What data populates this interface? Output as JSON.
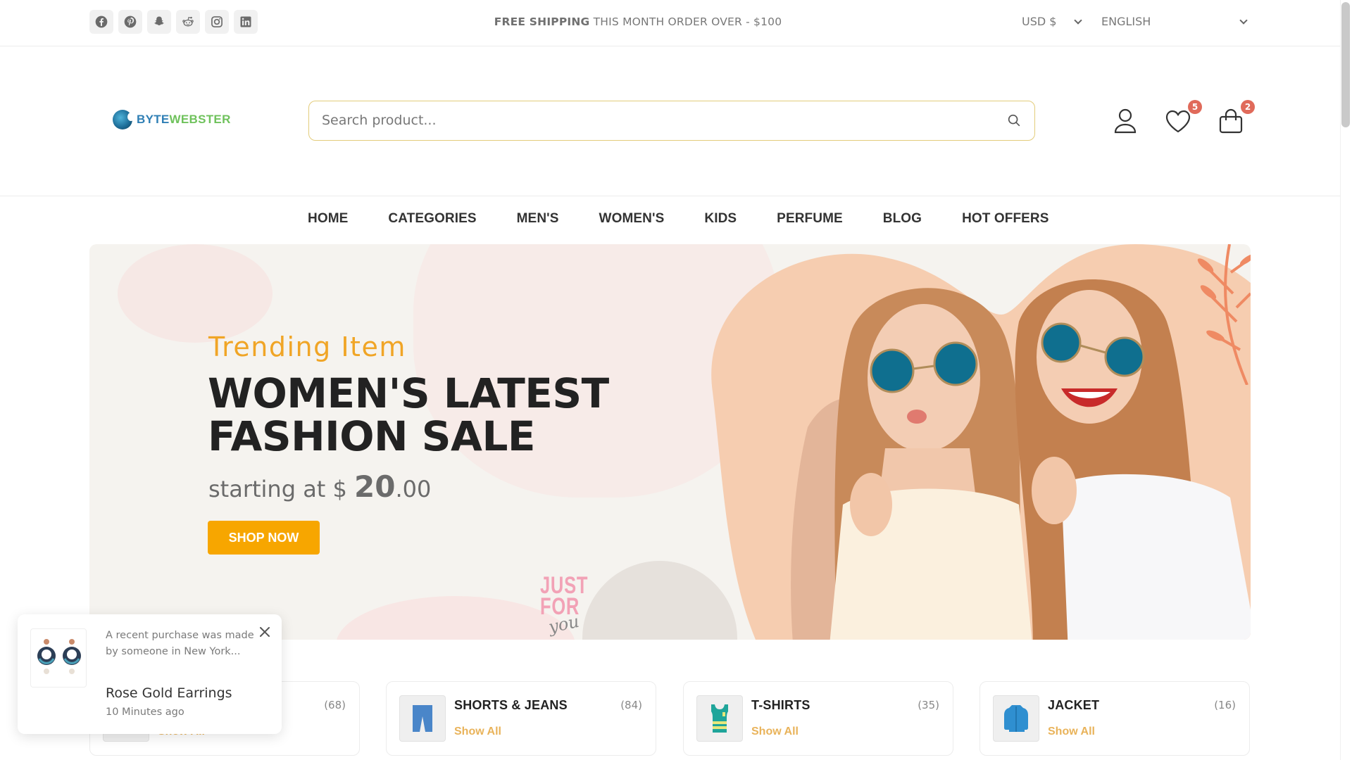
{
  "topbar": {
    "socials": [
      {
        "icon": "facebook-icon"
      },
      {
        "icon": "pinterest-icon"
      },
      {
        "icon": "snapchat-icon"
      },
      {
        "icon": "reddit-icon"
      },
      {
        "icon": "instagram-icon"
      },
      {
        "icon": "linkedin-icon"
      }
    ],
    "shipping_bold": "FREE SHIPPING",
    "shipping_rest": " THIS MONTH ORDER OVER - $100",
    "currency": "USD $",
    "language": "ENGLISH"
  },
  "header": {
    "logo_part1": "BYTE",
    "logo_part2": "WEBSTER",
    "search_placeholder": "Search product...",
    "wishlist_count": "5",
    "cart_count": "2"
  },
  "nav": {
    "items": [
      "HOME",
      "CATEGORIES",
      "MEN'S",
      "WOMEN'S",
      "KIDS",
      "PERFUME",
      "BLOG",
      "HOT OFFERS"
    ]
  },
  "hero": {
    "subtitle": "Trending Item",
    "title_line1": "WOMEN'S LATEST",
    "title_line2": "FASHION SALE",
    "price_prefix": "starting at $ ",
    "price_whole": "20",
    "price_cents": ".00",
    "cta": "SHOP NOW",
    "decor_just": "JUST",
    "decor_for": "FOR",
    "decor_you": "you"
  },
  "categories": [
    {
      "name": "",
      "count": "(68)",
      "link": "Show All"
    },
    {
      "name": "SHORTS & JEANS",
      "count": "(84)",
      "link": "Show All"
    },
    {
      "name": "T-SHIRTS",
      "count": "(35)",
      "link": "Show All"
    },
    {
      "name": "JACKET",
      "count": "(16)",
      "link": "Show All"
    }
  ],
  "toast": {
    "message": "A recent purchase was made by someone in New York...",
    "product": "Rose Gold Earrings",
    "time": "10 Minutes ago"
  },
  "colors": {
    "accent": "#f7a600",
    "trending": "#f0a526",
    "badge": "#e06a5a",
    "show_all": "#e9b35a",
    "search_border": "#e3cc7b"
  }
}
